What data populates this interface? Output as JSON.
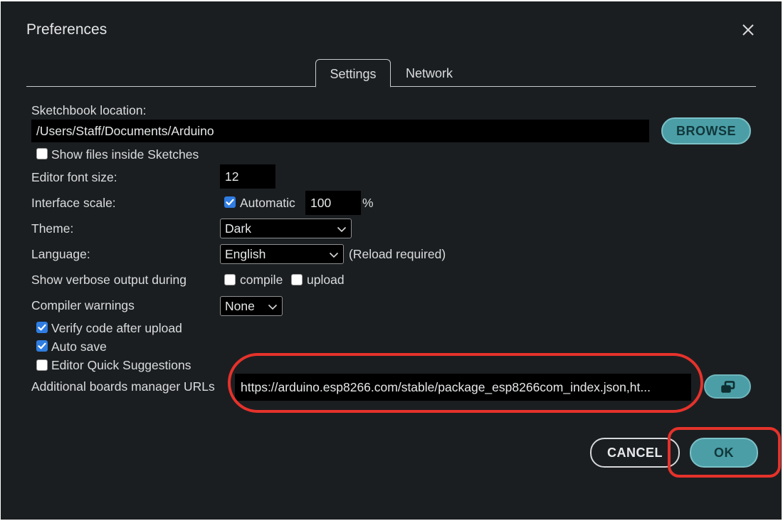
{
  "dialog": {
    "title": "Preferences",
    "close_icon": "close-icon"
  },
  "tabs": [
    {
      "label": "Settings",
      "active": true
    },
    {
      "label": "Network",
      "active": false
    }
  ],
  "settings": {
    "sketchbook_label": "Sketchbook location:",
    "sketchbook_path": "/Users/Staff/Documents/Arduino",
    "browse_label": "BROWSE",
    "show_files_label": "Show files inside Sketches",
    "show_files_checked": false,
    "font_size_label": "Editor font size:",
    "font_size_value": "12",
    "interface_scale_label": "Interface scale:",
    "automatic_label": "Automatic",
    "automatic_checked": true,
    "scale_value": "100",
    "scale_unit": "%",
    "theme_label": "Theme:",
    "theme_value": "Dark",
    "language_label": "Language:",
    "language_value": "English",
    "reload_note": "(Reload required)",
    "verbose_label": "Show verbose output during",
    "compile_label": "compile",
    "compile_checked": false,
    "upload_label": "upload",
    "upload_checked": false,
    "compiler_warnings_label": "Compiler warnings",
    "compiler_warnings_value": "None",
    "verify_label": "Verify code after upload",
    "verify_checked": true,
    "autosave_label": "Auto save",
    "autosave_checked": true,
    "quick_suggestions_label": "Editor Quick Suggestions",
    "quick_suggestions_checked": false,
    "boards_urls_label": "Additional boards manager URLs",
    "boards_urls_value": "https://arduino.esp8266.com/stable/package_esp8266com_index.json,ht...",
    "boards_urls_icon": "open-window-icon"
  },
  "footer": {
    "cancel_label": "CANCEL",
    "ok_label": "OK"
  },
  "colors": {
    "dialog_bg": "#1b1e21",
    "accent_teal": "#4b9ea6",
    "checkbox_blue": "#2f7de2",
    "annotation_red": "#e5322b"
  }
}
